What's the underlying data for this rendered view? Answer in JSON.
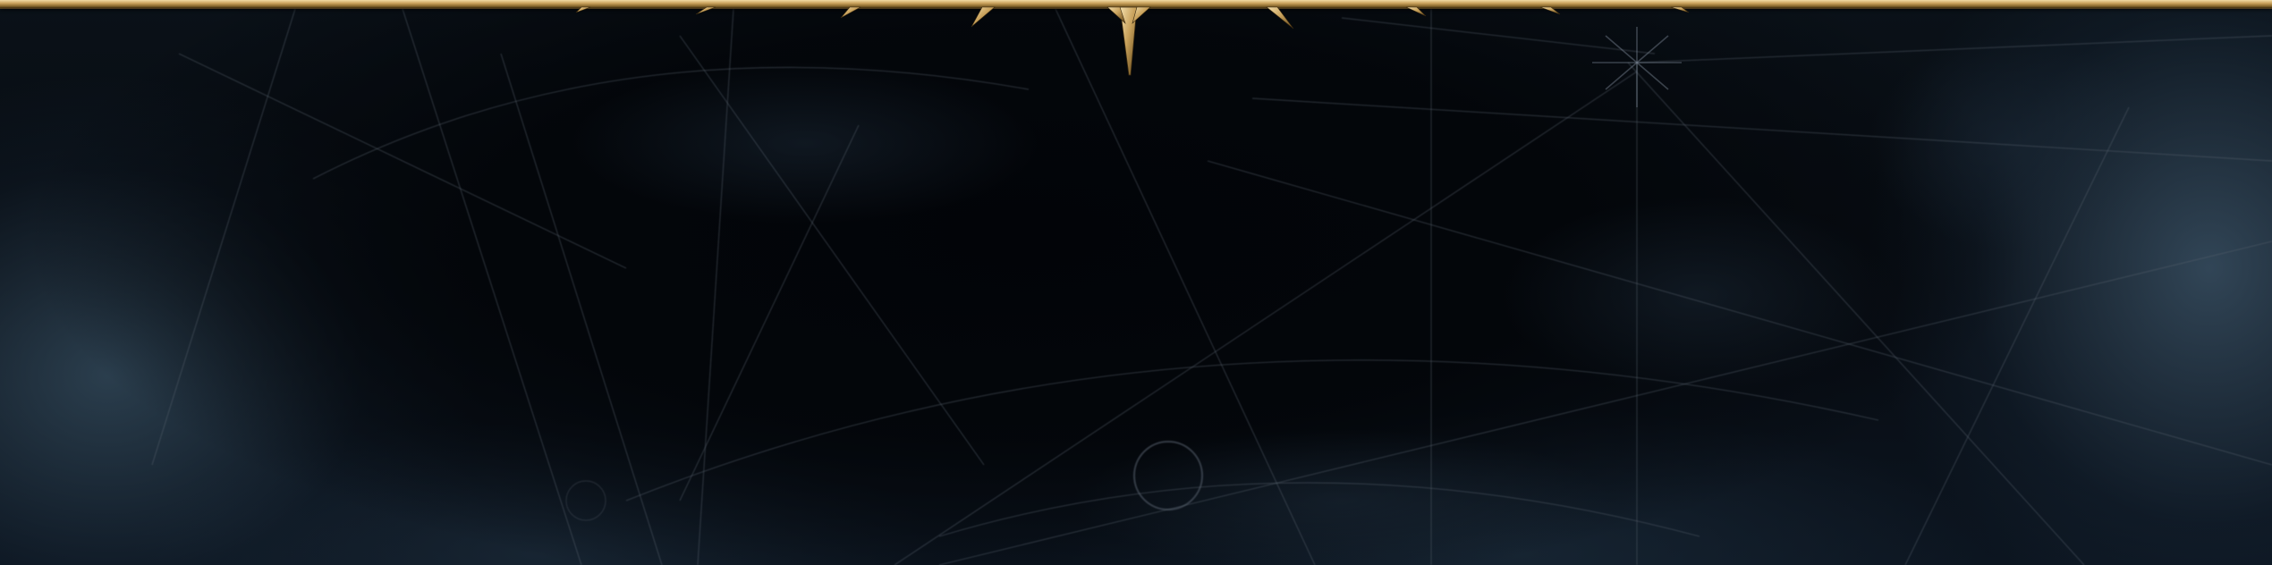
{
  "scene": {
    "label": "",
    "colors": {
      "gold_highlight": "#f2dba4",
      "gold_mid": "#c9a25c",
      "gold_shadow": "#8a6a2e",
      "background_dark": "#05080c",
      "background_edge": "#3a546a",
      "line_color": "#5a6470"
    },
    "icons": [
      "gold-border-bar",
      "center-spike-ornament",
      "small-spike-ornament",
      "compass-rose-lines",
      "circle-sigil"
    ]
  }
}
